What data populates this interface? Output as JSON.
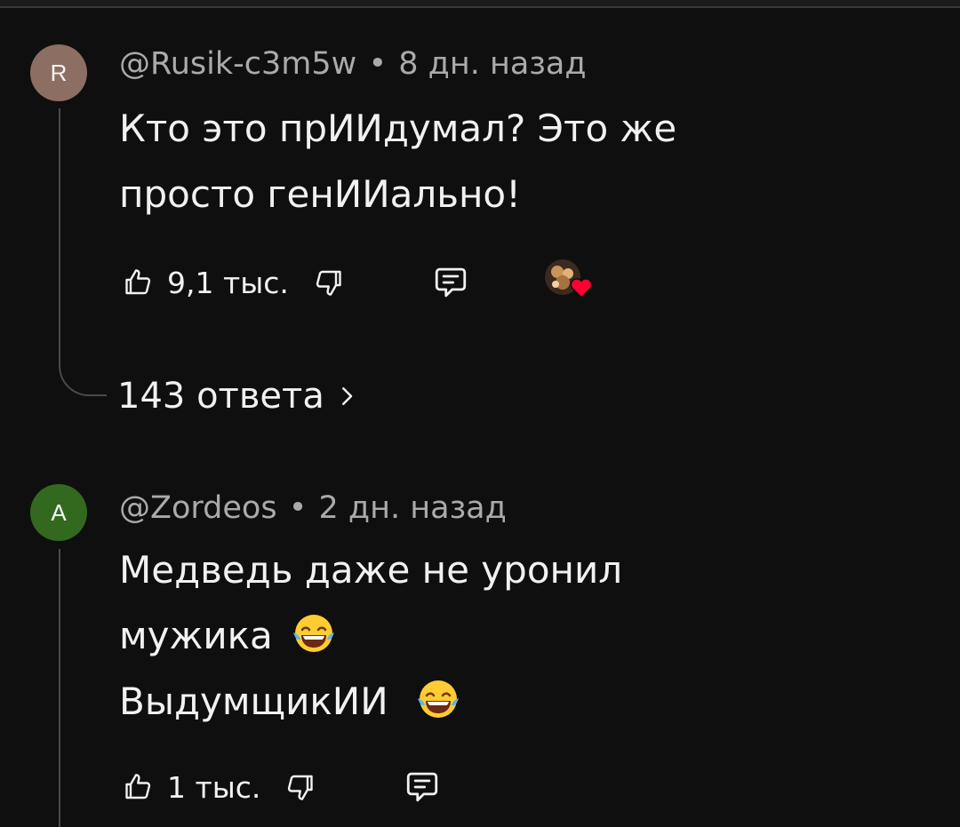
{
  "comments": [
    {
      "avatar_letter": "R",
      "avatar_color": "#8d6e63",
      "author": "@Rusik-c3m5w",
      "separator": "•",
      "time": "8 дн. назад",
      "lines": [
        "Кто это прИИдумал? Это же",
        "просто генИИально!"
      ],
      "likes": "9,1 тыс.",
      "creator_heart_icon": "creator-heart-icon",
      "replies_label": "143 ответа"
    },
    {
      "avatar_letter": "A",
      "avatar_color": "#33691e",
      "author": "@Zordeos",
      "separator": "•",
      "time": "2 дн. назад",
      "lines": [
        "Медведь даже не уронил",
        "мужика",
        "ВыдумщикИИ"
      ],
      "likes": "1 тыс."
    }
  ]
}
